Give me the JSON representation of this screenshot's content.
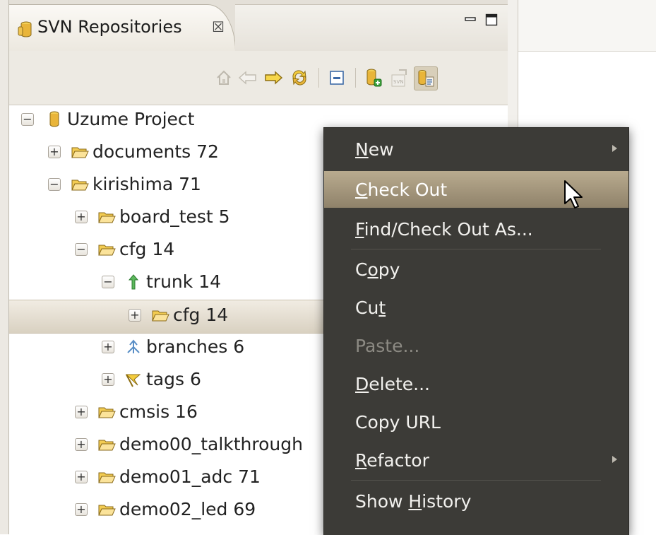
{
  "view": {
    "title": "SVN Repositories",
    "close_glyph": "☒",
    "title_icon": "svn-repository-icon"
  },
  "toolbar": {
    "buttons": [
      "home-icon",
      "back-icon",
      "forward-icon",
      "refresh-icon",
      "collapse-all-icon",
      "new-repository-location-icon",
      "svn-checkout-icon",
      "link-with-editor-icon"
    ]
  },
  "tree": {
    "nodes": [
      {
        "label": "Uzume Project",
        "toggle": "−",
        "icon": "repository-icon"
      },
      {
        "label": "documents 72",
        "toggle": "+",
        "icon": "folder-icon"
      },
      {
        "label": "kirishima 71",
        "toggle": "−",
        "icon": "folder-icon"
      },
      {
        "label": "board_test 5",
        "toggle": "+",
        "icon": "folder-icon"
      },
      {
        "label": "cfg 14",
        "toggle": "−",
        "icon": "folder-icon"
      },
      {
        "label": "trunk 14",
        "toggle": "−",
        "icon": "trunk-icon"
      },
      {
        "label": "cfg 14",
        "toggle": "+",
        "icon": "folder-icon",
        "selected": true
      },
      {
        "label": "branches 6",
        "toggle": "+",
        "icon": "branches-icon"
      },
      {
        "label": "tags 6",
        "toggle": "+",
        "icon": "tags-icon"
      },
      {
        "label": "cmsis 16",
        "toggle": "+",
        "icon": "folder-icon"
      },
      {
        "label": "demo00_talkthrough",
        "toggle": "+",
        "icon": "folder-icon"
      },
      {
        "label": "demo01_adc 71",
        "toggle": "+",
        "icon": "folder-icon"
      },
      {
        "label": "demo02_led 69",
        "toggle": "+",
        "icon": "folder-icon"
      }
    ]
  },
  "context_menu": {
    "items": [
      {
        "pre": "",
        "u": "N",
        "post": "ew",
        "submenu": true
      },
      {
        "pre": "",
        "u": "C",
        "post": "heck Out",
        "highlighted": true
      },
      {
        "pre": "",
        "u": "F",
        "post": "ind/Check Out As..."
      },
      {
        "pre": "C",
        "u": "o",
        "post": "py"
      },
      {
        "pre": "Cu",
        "u": "t",
        "post": ""
      },
      {
        "pre": "Paste...",
        "u": "",
        "post": "",
        "disabled": true
      },
      {
        "pre": "",
        "u": "D",
        "post": "elete..."
      },
      {
        "pre": "Copy URL",
        "u": "",
        "post": ""
      },
      {
        "pre": "",
        "u": "R",
        "post": "efactor",
        "submenu": true
      },
      {
        "pre": "Show ",
        "u": "H",
        "post": "istory"
      }
    ]
  },
  "colors": {
    "menu_bg": "#3c3b37",
    "menu_highlight": "#a89a7e",
    "selection": "#e2dacb",
    "folder": "#e8b64a"
  }
}
